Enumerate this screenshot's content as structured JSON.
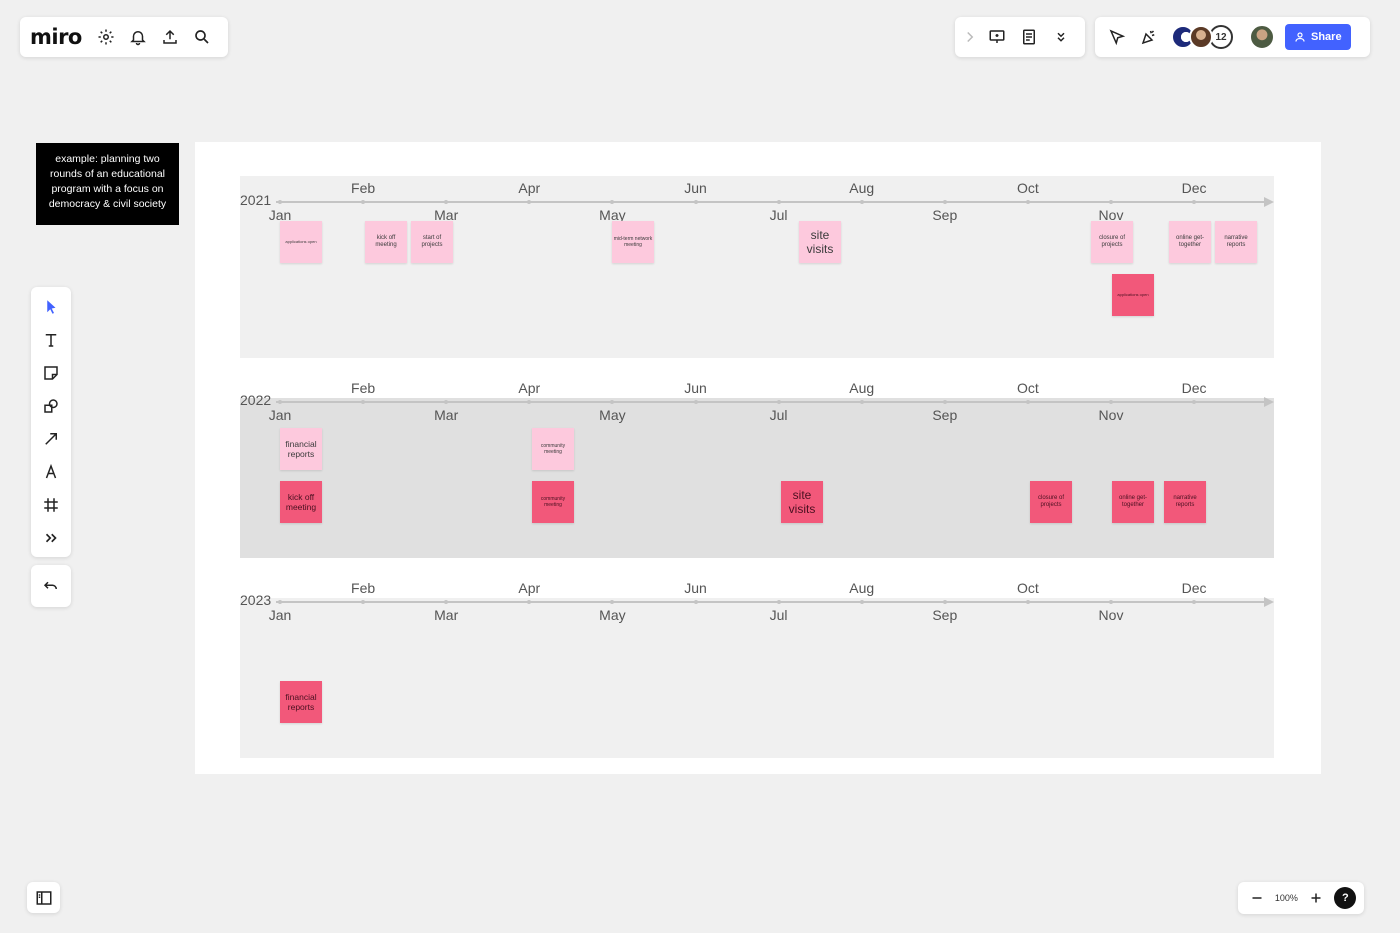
{
  "app": {
    "logo": "miro",
    "share_label": "Share",
    "avatar_count": "12",
    "zoom": "100%",
    "help": "?"
  },
  "note": "example: planning two rounds of an educational program with a focus on democracy & civil society",
  "timelines": [
    {
      "year": "2021",
      "months_top": [
        "Feb",
        "Apr",
        "Jun",
        "Aug",
        "Oct",
        "Dec"
      ],
      "months_bottom": [
        "Jan",
        "Mar",
        "May",
        "Jul",
        "Sep",
        "Nov"
      ],
      "notes": [
        {
          "text": "applications open",
          "color": "light"
        },
        {
          "text": "kick off meeting",
          "color": "light"
        },
        {
          "text": "start of projects",
          "color": "light"
        },
        {
          "text": "mid-term network meeting",
          "color": "light"
        },
        {
          "text": "site visits",
          "color": "light"
        },
        {
          "text": "closure of projects",
          "color": "light"
        },
        {
          "text": "online get-together",
          "color": "light"
        },
        {
          "text": "narrative reports",
          "color": "light"
        },
        {
          "text": "applications open",
          "color": "dark"
        }
      ]
    },
    {
      "year": "2022",
      "months_top": [
        "Feb",
        "Apr",
        "Jun",
        "Aug",
        "Oct",
        "Dec"
      ],
      "months_bottom": [
        "Jan",
        "Mar",
        "May",
        "Jul",
        "Sep",
        "Nov"
      ],
      "notes": [
        {
          "text": "financial reports",
          "color": "light"
        },
        {
          "text": "community meeting",
          "color": "light"
        },
        {
          "text": "kick off meeting",
          "color": "dark"
        },
        {
          "text": "community meeting",
          "color": "dark"
        },
        {
          "text": "site visits",
          "color": "dark"
        },
        {
          "text": "closure of projects",
          "color": "dark"
        },
        {
          "text": "online get-together",
          "color": "dark"
        },
        {
          "text": "narrative reports",
          "color": "dark"
        }
      ]
    },
    {
      "year": "2023",
      "months_top": [
        "Feb",
        "Apr",
        "Jun",
        "Aug",
        "Oct",
        "Dec"
      ],
      "months_bottom": [
        "Jan",
        "Mar",
        "May",
        "Jul",
        "Sep",
        "Nov"
      ],
      "notes": [
        {
          "text": "financial reports",
          "color": "dark"
        }
      ]
    }
  ]
}
